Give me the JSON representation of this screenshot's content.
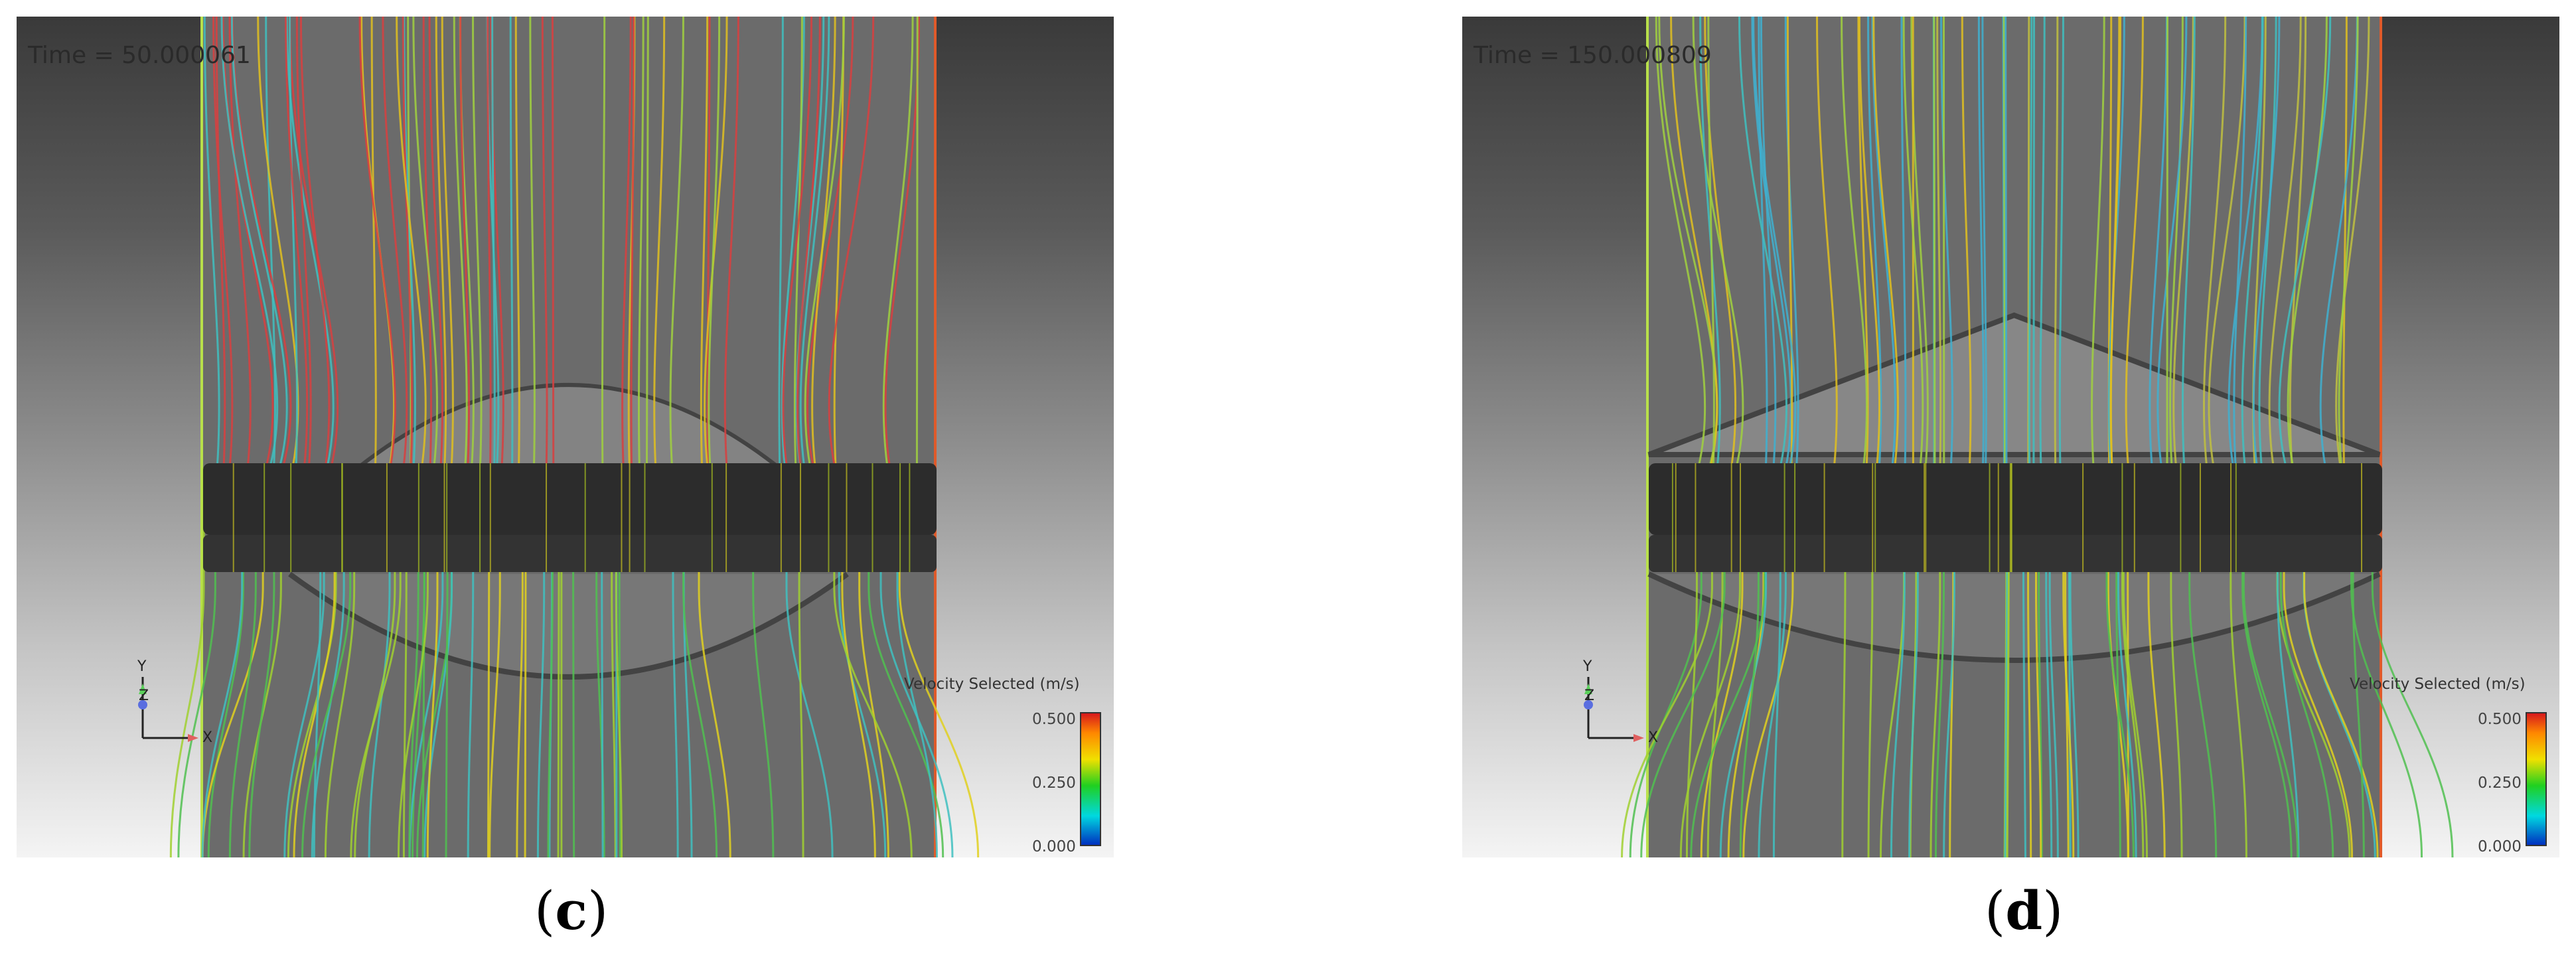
{
  "panels": [
    {
      "id": "c",
      "time_label": "Time = 50.000061",
      "caption_open": "(",
      "caption_letter": "c",
      "caption_close": ")"
    },
    {
      "id": "d",
      "time_label": "Time = 150.000809",
      "caption_open": "(",
      "caption_letter": "d",
      "caption_close": ")"
    }
  ],
  "legend": {
    "title": "Velocity Selected (m/s)",
    "ticks": [
      "0.500",
      "0.250",
      "0.000"
    ],
    "min": 0.0,
    "max": 0.5,
    "colors": [
      "#d7191c",
      "#ff8800",
      "#f0e000",
      "#20d020",
      "#00d8e0",
      "#0030c0"
    ]
  },
  "axes": {
    "x": "X",
    "y": "Y",
    "z": "Z"
  }
}
